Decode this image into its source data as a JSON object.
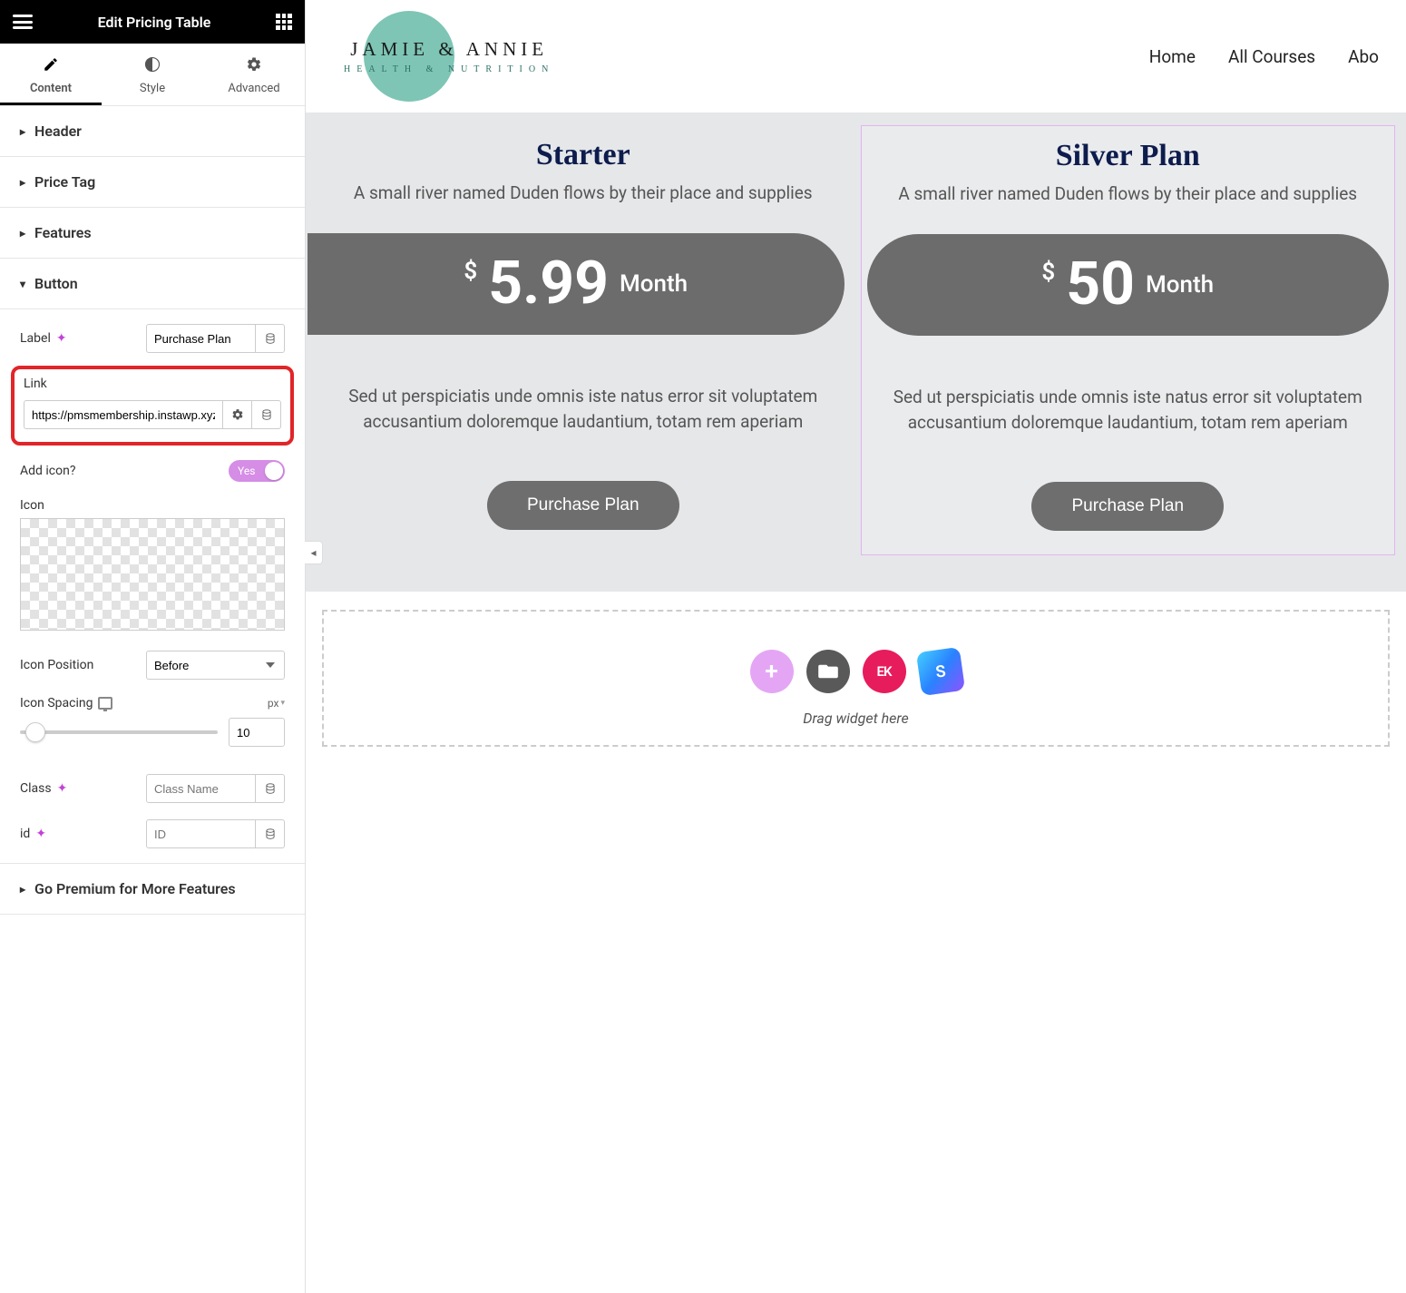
{
  "editor": {
    "title": "Edit Pricing Table",
    "tabs": {
      "content": "Content",
      "style": "Style",
      "advanced": "Advanced"
    },
    "sections": {
      "header": "Header",
      "price_tag": "Price Tag",
      "features": "Features",
      "button": "Button",
      "premium": "Go Premium for More Features"
    },
    "button": {
      "label_label": "Label",
      "label_value": "Purchase Plan",
      "link_label": "Link",
      "link_value": "https://pmsmembership.instawp.xyz",
      "add_icon_label": "Add icon?",
      "add_icon_value": "Yes",
      "icon_label": "Icon",
      "icon_position_label": "Icon Position",
      "icon_position_value": "Before",
      "icon_spacing_label": "Icon Spacing",
      "icon_spacing_unit": "px",
      "icon_spacing_value": "10",
      "class_label": "Class",
      "class_placeholder": "Class Name",
      "id_label": "id",
      "id_placeholder": "ID"
    }
  },
  "site": {
    "logo_main": "JAMIE & ANNIE",
    "logo_sub": "HEALTH & NUTRITION",
    "nav": {
      "home": "Home",
      "courses": "All Courses",
      "about": "Abo"
    }
  },
  "plans": [
    {
      "title": "Starter",
      "desc": "A small river named Duden flows by their place and supplies",
      "currency": "$",
      "amount": "5.99",
      "period": "Month",
      "body": "Sed ut perspiciatis unde omnis iste natus error sit voluptatem accusantium doloremque laudantium, totam rem aperiam",
      "button": "Purchase Plan"
    },
    {
      "title": "Silver Plan",
      "desc": "A small river named Duden flows by their place and supplies",
      "currency": "$",
      "amount": "50",
      "period": "Month",
      "body": "Sed ut perspiciatis unde omnis iste natus error sit voluptatem accusantium doloremque laudantium, totam rem aperiam",
      "button": "Purchase Plan"
    }
  ],
  "drop": {
    "label": "Drag widget here",
    "ek": "EK",
    "s": "S"
  }
}
